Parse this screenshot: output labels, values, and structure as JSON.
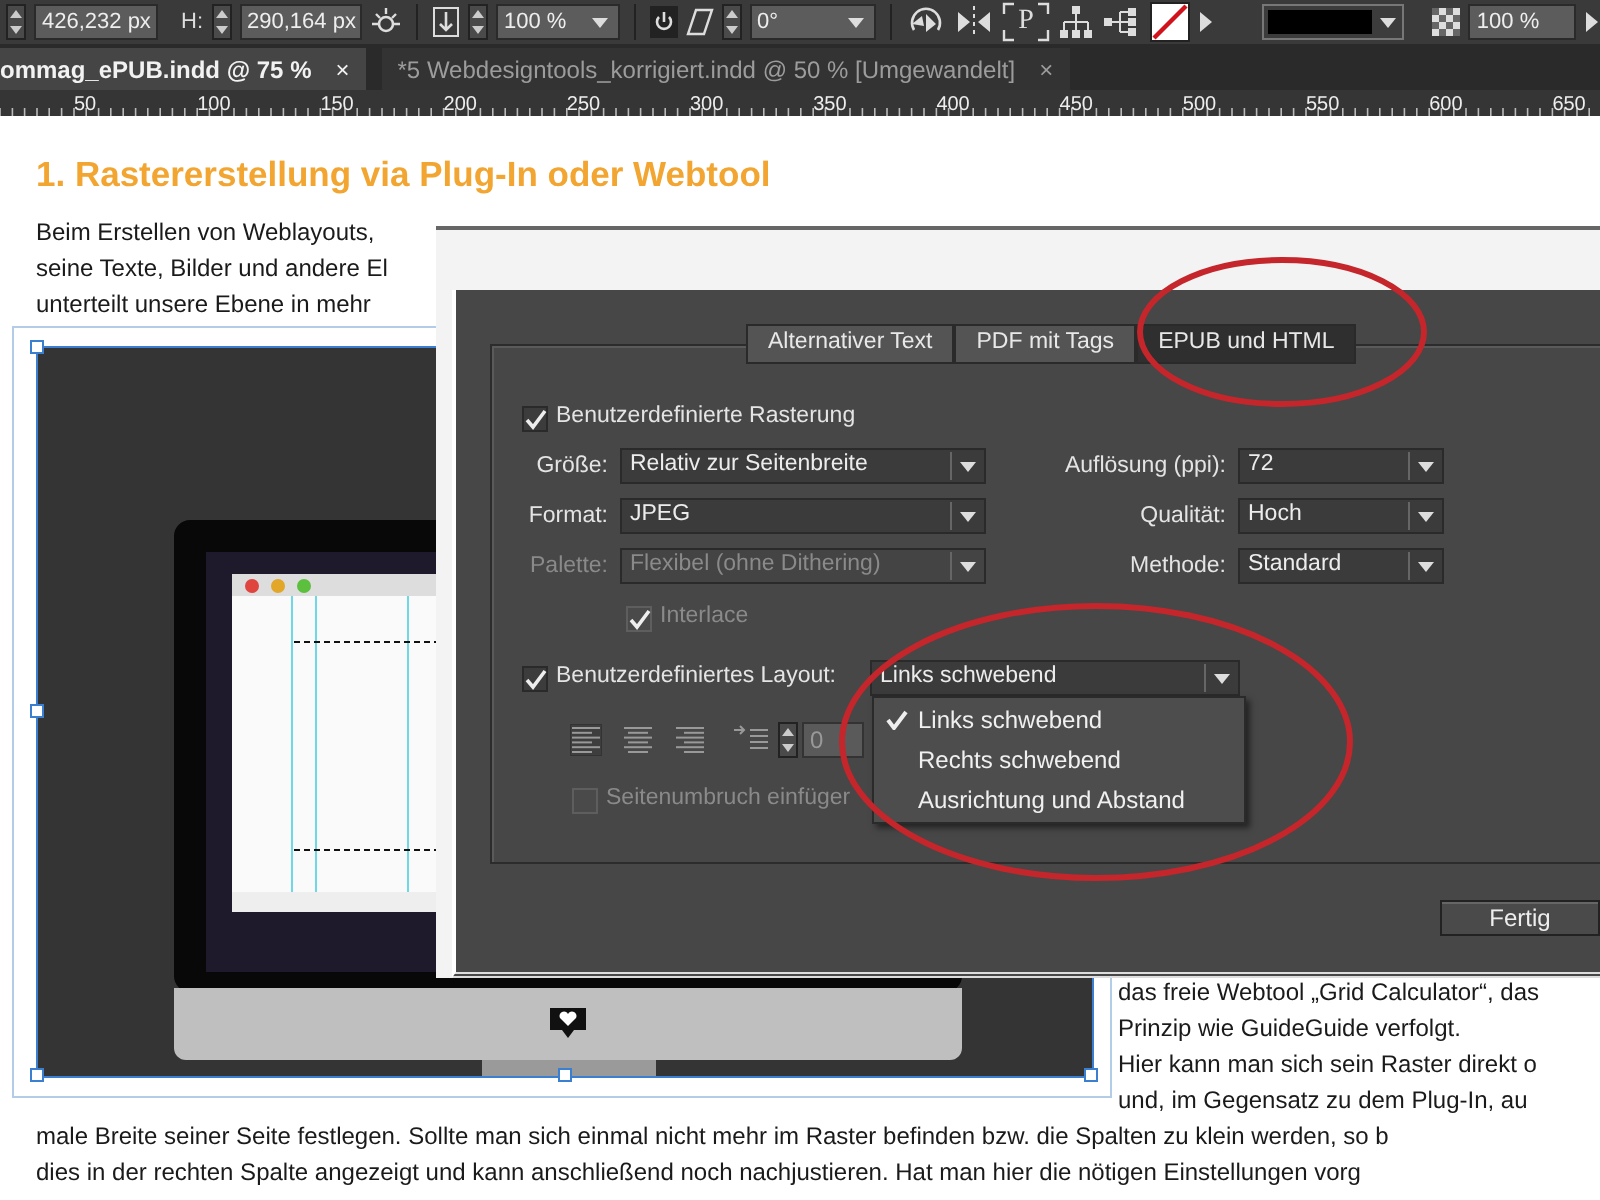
{
  "toolbar": {
    "width_value": "426,232 px",
    "height_label": "H:",
    "height_value": "290,164 px",
    "scale_value": "100 %",
    "shear_value": "0°",
    "frame_glyph": "P",
    "opacity_value": "100 %"
  },
  "document_tabs": [
    {
      "label": "ommag_ePUB.indd @ 75 %",
      "close": "×",
      "selected": true
    },
    {
      "label": "*5 Webdesigntools_korrigiert.indd @ 50 % [Umgewandelt]",
      "close": "×",
      "selected": false
    }
  ],
  "ruler": {
    "labels": [
      "50",
      "100",
      "150",
      "200",
      "250",
      "300",
      "350",
      "400",
      "450",
      "500",
      "550",
      "600",
      "650"
    ]
  },
  "article": {
    "heading": "1. Rastererstellung via Plug-In oder Webtool",
    "intro_lines": [
      "Beim Erstellen von Weblayouts,",
      "seine Texte, Bilder und andere El",
      "unterteilt unsere Ebene in mehr"
    ],
    "side_lines": [
      "das freie Webtool „Grid Calculator“, das",
      "Prinzip wie GuideGuide verfolgt.",
      "Hier kann man sich sein Raster direkt o",
      "und, im Gegensatz zu dem Plug-In, au"
    ],
    "bottom_lines": [
      "male Breite seiner Seite festlegen. Sollte man sich einmal nicht mehr im Raster befinden bzw. die Spalten zu klein werden, so b",
      "dies in der rechten Spalte angezeigt und kann anschließend noch nachjustieren. Hat man hier die nötigen Einstellungen vorg"
    ]
  },
  "dialog": {
    "tabs": [
      {
        "label": "Alternativer Text",
        "selected": false
      },
      {
        "label": "PDF mit Tags",
        "selected": false
      },
      {
        "label": "EPUB und HTML",
        "selected": true
      }
    ],
    "custom_rasterization": {
      "label": "Benutzerdefinierte Rasterung",
      "checked": true
    },
    "fields": [
      {
        "label": "Größe:",
        "value": "Relativ zur Seitenbreite",
        "disabled": false
      },
      {
        "label": "Auflösung (ppi):",
        "value": "72",
        "disabled": false
      },
      {
        "label": "Format:",
        "value": "JPEG",
        "disabled": false
      },
      {
        "label": "Qualität:",
        "value": "Hoch",
        "disabled": false
      },
      {
        "label": "Palette:",
        "value": "Flexibel (ohne Dithering)",
        "disabled": true
      },
      {
        "label": "Methode:",
        "value": "Standard",
        "disabled": false
      }
    ],
    "interlace": {
      "label": "Interlace",
      "checked": true,
      "disabled": true
    },
    "custom_layout": {
      "label": "Benutzerdefiniertes Layout:",
      "checked": true,
      "value": "Links schwebend"
    },
    "layout_menu": [
      {
        "label": "Links schwebend",
        "selected": true
      },
      {
        "label": "Rechts schwebend",
        "selected": false
      },
      {
        "label": "Ausrichtung und Abstand",
        "selected": false
      }
    ],
    "spacing_value": "0",
    "page_break": {
      "label": "Seitenumbruch einfüger",
      "checked": false,
      "disabled": true
    },
    "done_button": "Fertig"
  }
}
